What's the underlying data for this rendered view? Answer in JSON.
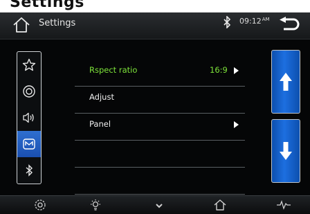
{
  "page_heading": "Settings",
  "header": {
    "title": "Settings",
    "time": "09:12",
    "ampm": "AM",
    "home_icon": "home-icon",
    "bluetooth_icon": "bluetooth-icon",
    "back_icon": "back-arrow-icon"
  },
  "sidebar": {
    "items": [
      {
        "icon": "star-icon",
        "selected": false
      },
      {
        "icon": "disc-icon",
        "selected": false
      },
      {
        "icon": "speaker-icon",
        "selected": false
      },
      {
        "icon": "display-icon",
        "selected": true
      },
      {
        "icon": "bluetooth-icon",
        "selected": false
      }
    ],
    "selected_color": "#2a66c9"
  },
  "settings_rows": [
    {
      "label": "Rspect ratio",
      "value": "16:9",
      "has_arrow": true,
      "highlighted": true
    },
    {
      "label": "Adjust",
      "value": "",
      "has_arrow": false,
      "highlighted": false
    },
    {
      "label": "Panel",
      "value": "",
      "has_arrow": true,
      "highlighted": false
    },
    {
      "label": "",
      "value": "",
      "has_arrow": false,
      "highlighted": false
    },
    {
      "label": "",
      "value": "",
      "has_arrow": false,
      "highlighted": false
    }
  ],
  "scroll": {
    "up_icon": "arrow-up-icon",
    "down_icon": "arrow-down-icon"
  },
  "dock": {
    "items": [
      "settings-gear-icon",
      "brightness-icon",
      "chevron-down-icon",
      "home-icon",
      "equalizer-icon"
    ]
  },
  "colors": {
    "accent_green": "#7ee43a",
    "accent_blue": "#1d6fe0"
  }
}
